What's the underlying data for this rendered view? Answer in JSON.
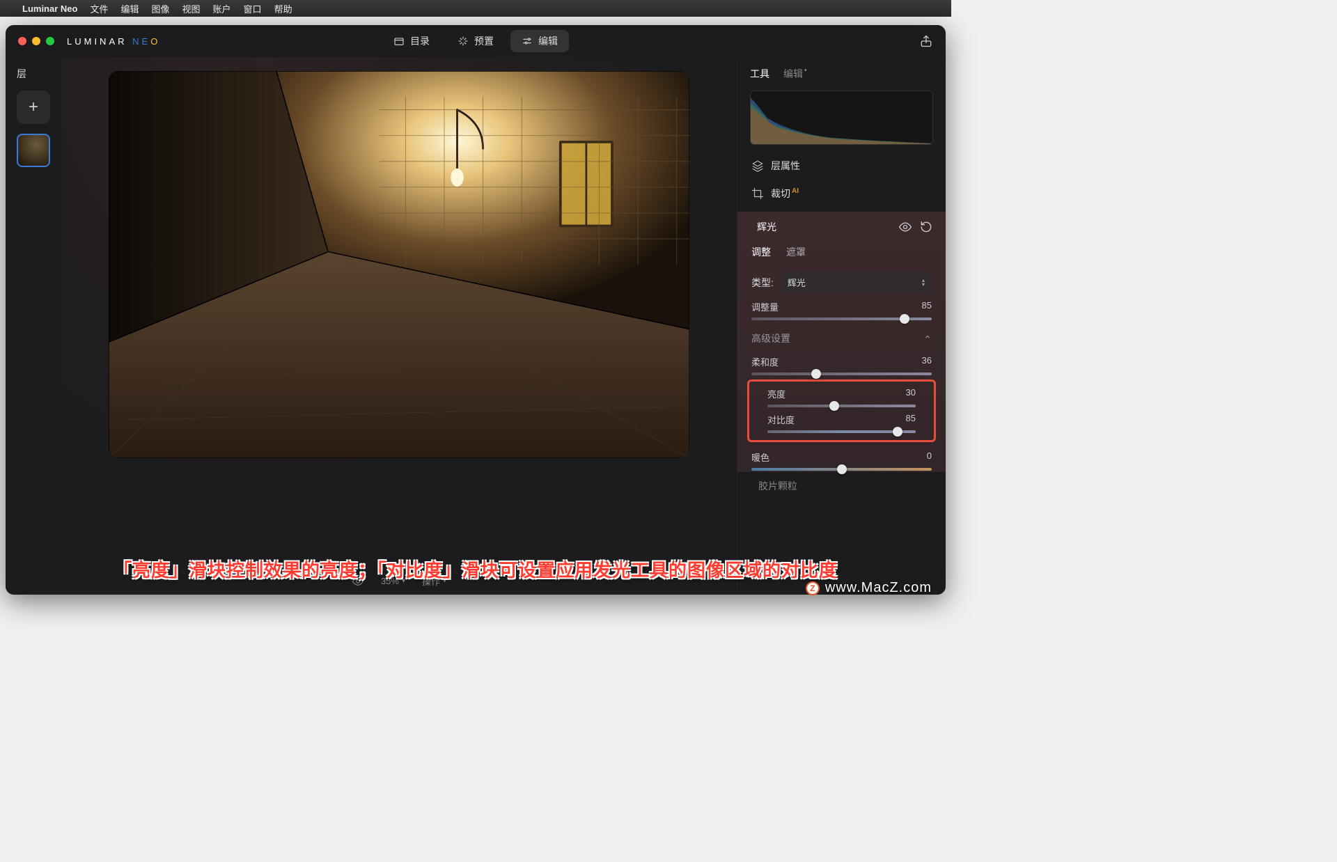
{
  "menubar": {
    "app": "Luminar Neo",
    "items": [
      "文件",
      "编辑",
      "图像",
      "视图",
      "账户",
      "窗口",
      "帮助"
    ]
  },
  "logo": {
    "part1": "LUMINAR ",
    "part2": "N",
    "part3": "E",
    "part4": "O"
  },
  "top_tabs": {
    "catalog": "目录",
    "presets": "预置",
    "edit": "编辑"
  },
  "layers": {
    "title": "层"
  },
  "canvas_footer": {
    "zoom": "35%",
    "actions": "操作"
  },
  "right": {
    "tabs": {
      "tools": "工具",
      "edit": "编辑"
    },
    "layer_props": "层属性",
    "crop": "裁切",
    "crop_badge": "AI"
  },
  "glow": {
    "title": "辉光",
    "subtabs": {
      "adjust": "调整",
      "mask": "遮罩"
    },
    "type_label": "类型:",
    "type_value": "辉光",
    "amount_label": "调整量",
    "amount_value": "85",
    "advanced": "高级设置",
    "softness_label": "柔和度",
    "softness_value": "36",
    "brightness_label": "亮度",
    "brightness_value": "30",
    "contrast_label": "对比度",
    "contrast_value": "85",
    "warmth_label": "暖色",
    "warmth_value": "0",
    "film_grain": "胶片颗粒"
  },
  "annotation": "「亮度」滑块控制效果的亮度；「对比度」滑块可设置应用发光工具的图像区域的对比度",
  "watermark": {
    "badge": "Z",
    "text": "www.MacZ.com"
  }
}
